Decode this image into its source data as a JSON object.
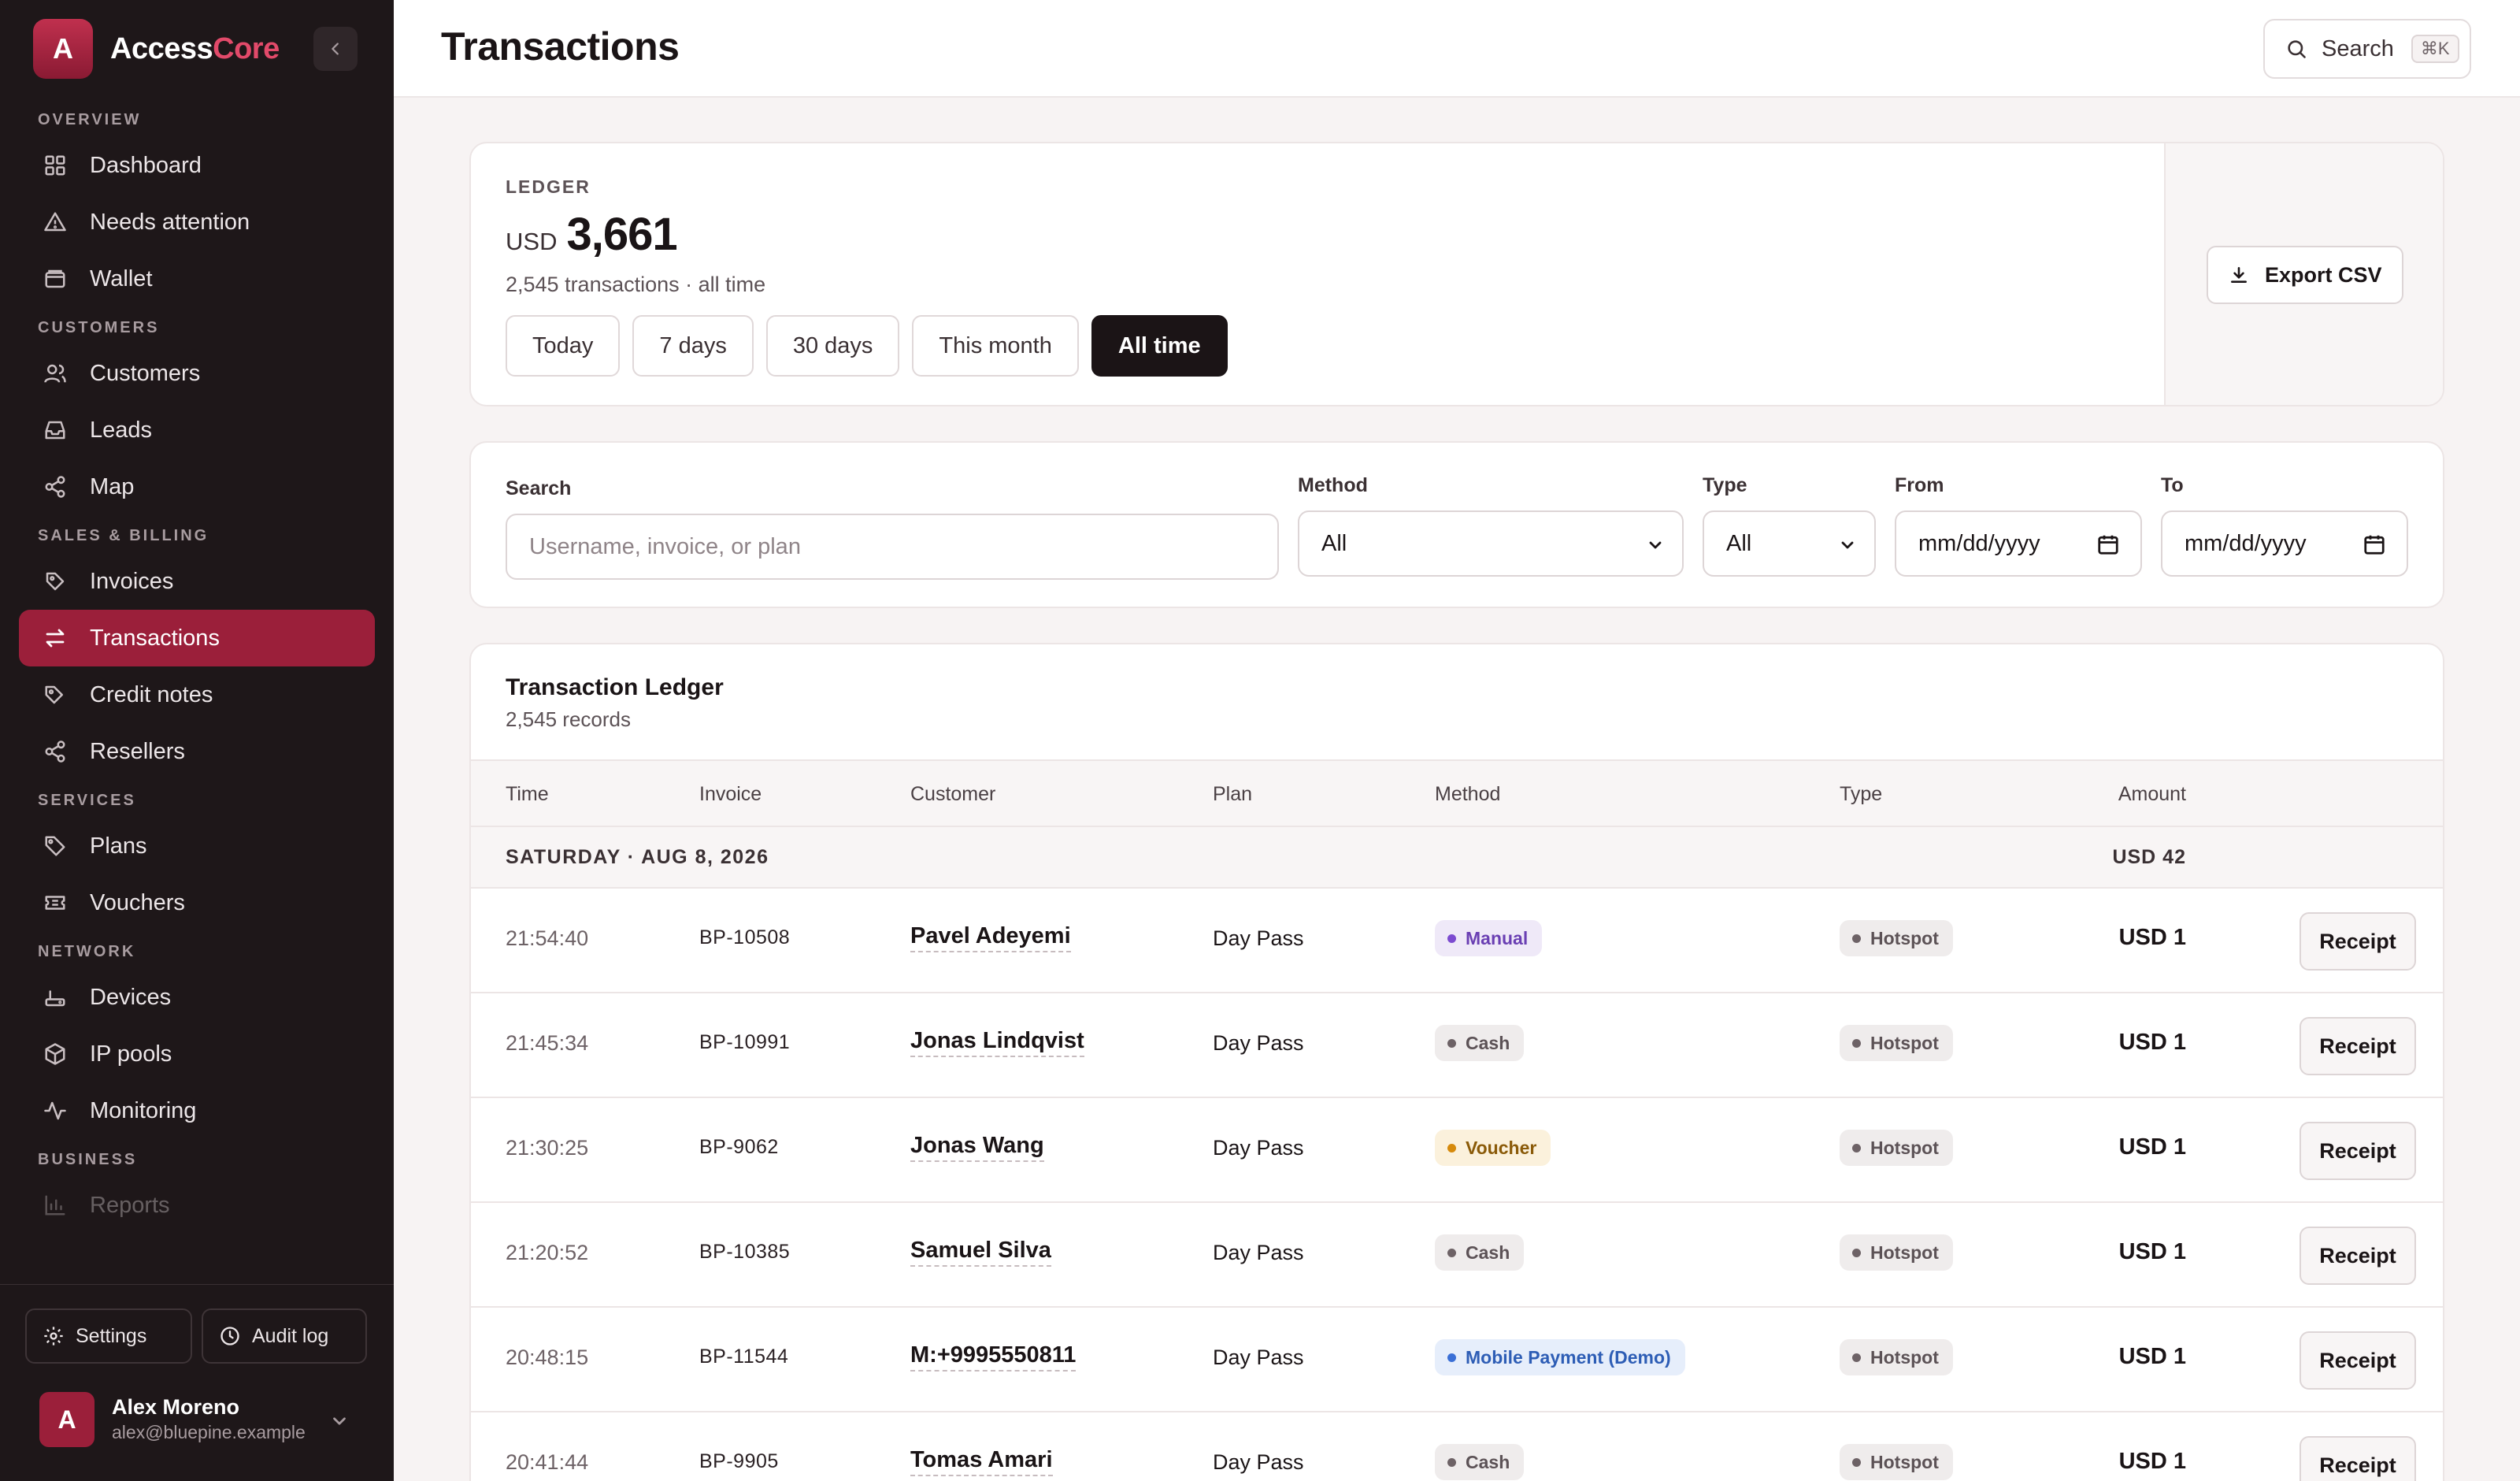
{
  "app": {
    "brand_first": "Access",
    "brand_second": "Core",
    "logo_letter": "A",
    "accent": "#9b1f3a"
  },
  "header": {
    "title": "Transactions",
    "search_label": "Search",
    "search_shortcut": "⌘K"
  },
  "sidebar": {
    "sections": {
      "overview": "OVERVIEW",
      "customers": "CUSTOMERS",
      "sales": "SALES & BILLING",
      "services": "SERVICES",
      "network": "NETWORK",
      "business": "BUSINESS"
    },
    "items": {
      "dashboard": "Dashboard",
      "needs_attention": "Needs attention",
      "wallet": "Wallet",
      "customers": "Customers",
      "leads": "Leads",
      "map": "Map",
      "invoices": "Invoices",
      "transactions": "Transactions",
      "credit_notes": "Credit notes",
      "resellers": "Resellers",
      "plans": "Plans",
      "vouchers": "Vouchers",
      "devices": "Devices",
      "ip_pools": "IP pools",
      "monitoring": "Monitoring",
      "reports": "Reports"
    },
    "active_item": "Transactions",
    "footer": {
      "settings": "Settings",
      "audit_log": "Audit log"
    },
    "user": {
      "initial": "A",
      "name": "Alex Moreno",
      "email": "alex@bluepine.example"
    }
  },
  "ledger": {
    "label": "LEDGER",
    "currency": "USD",
    "total": "3,661",
    "summary": "2,545 transactions · all time",
    "ranges": [
      "Today",
      "7 days",
      "30 days",
      "This month",
      "All time"
    ],
    "active_range": "All time",
    "export_label": "Export CSV"
  },
  "filters": {
    "search_label": "Search",
    "search_placeholder": "Username, invoice, or plan",
    "method_label": "Method",
    "method_value": "All",
    "type_label": "Type",
    "type_value": "All",
    "from_label": "From",
    "from_value": "mm/dd/yyyy",
    "to_label": "To",
    "to_value": "mm/dd/yyyy"
  },
  "table": {
    "title": "Transaction Ledger",
    "subtitle": "2,545 records",
    "columns": {
      "time": "Time",
      "invoice": "Invoice",
      "customer": "Customer",
      "plan": "Plan",
      "method": "Method",
      "type": "Type",
      "amount": "Amount"
    },
    "group": {
      "label": "SATURDAY · AUG 8, 2026",
      "total": "USD 42"
    },
    "receipt_label": "Receipt",
    "rows": [
      {
        "time": "21:54:40",
        "invoice": "BP-10508",
        "customer": "Pavel Adeyemi",
        "plan": "Day Pass",
        "method": "Manual",
        "type": "Hotspot",
        "amount": "USD 1"
      },
      {
        "time": "21:45:34",
        "invoice": "BP-10991",
        "customer": "Jonas Lindqvist",
        "plan": "Day Pass",
        "method": "Cash",
        "type": "Hotspot",
        "amount": "USD 1"
      },
      {
        "time": "21:30:25",
        "invoice": "BP-9062",
        "customer": "Jonas Wang",
        "plan": "Day Pass",
        "method": "Voucher",
        "type": "Hotspot",
        "amount": "USD 1"
      },
      {
        "time": "21:20:52",
        "invoice": "BP-10385",
        "customer": "Samuel Silva",
        "plan": "Day Pass",
        "method": "Cash",
        "type": "Hotspot",
        "amount": "USD 1"
      },
      {
        "time": "20:48:15",
        "invoice": "BP-11544",
        "customer": "M:+9995550811",
        "plan": "Day Pass",
        "method": "Mobile Payment (Demo)",
        "type": "Hotspot",
        "amount": "USD 1"
      },
      {
        "time": "20:41:44",
        "invoice": "BP-9905",
        "customer": "Tomas Amari",
        "plan": "Day Pass",
        "method": "Cash",
        "type": "Hotspot",
        "amount": "USD 1"
      }
    ]
  }
}
